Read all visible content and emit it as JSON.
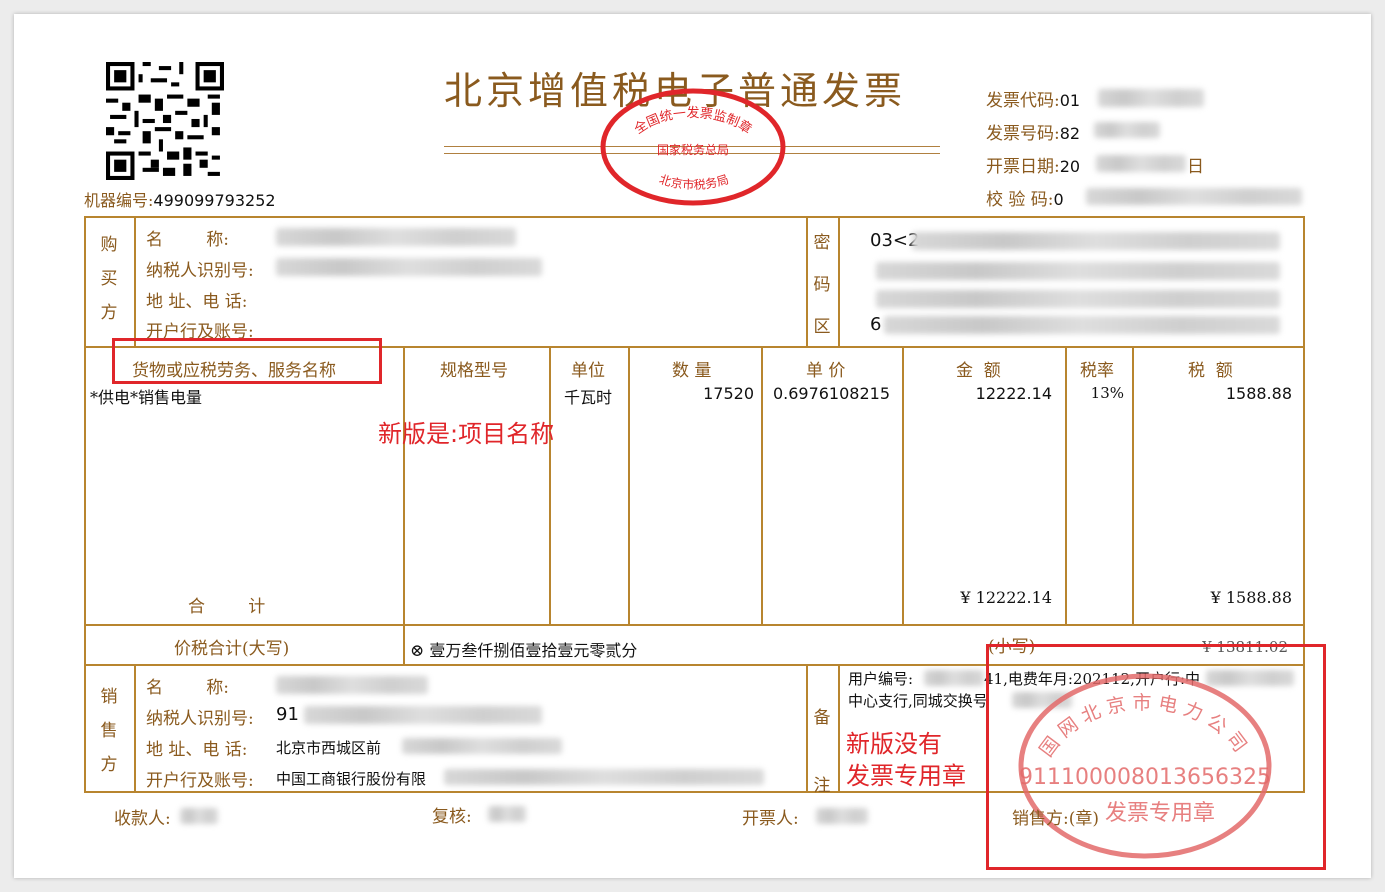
{
  "invoice": {
    "title": "北京增值税电子普通发票",
    "machine_no_label": "机器编号:",
    "machine_no": "499099793252",
    "code_label": "发票代码:",
    "code_visible": "01",
    "number_label": "发票号码:",
    "number_visible": "82",
    "date_label": "开票日期:",
    "date_visible": "20",
    "date_suffix": "日",
    "check_label": "校 验 码:",
    "check_visible": "0"
  },
  "seal_top": {
    "outer_text": "全国统一发票监制章",
    "middle": "国家税务总局",
    "bottom": "北京市税务局"
  },
  "buyer": {
    "side_label": "购买方",
    "name_label": "名        称:",
    "tax_id_label": "纳税人识别号:",
    "address_label": "地 址、电 话:",
    "bank_label": "开户行及账号:"
  },
  "cipher": {
    "side_label": "密码区",
    "line1": "03<2",
    "line2": "",
    "line4": "6"
  },
  "items_header": {
    "name": "货物或应税劳务、服务名称",
    "spec": "规格型号",
    "unit": "单位",
    "qty": "数 量",
    "price": "单 价",
    "amount": "金  额",
    "rate": "税率",
    "tax": "税  额"
  },
  "items": [
    {
      "name": "*供电*销售电量",
      "spec": "",
      "unit": "千瓦时",
      "qty": "17520",
      "price": "0.6976108215",
      "amount": "12222.14",
      "rate": "13%",
      "tax": "1588.88"
    }
  ],
  "totals": {
    "label": "合        计",
    "amount": "¥ 12222.14",
    "tax": "¥ 1588.88",
    "total_label": "价税合计(大写)",
    "total_words": "壹万叁仟捌佰壹拾壹元零贰分",
    "small_label": "(小写)",
    "small_value": "¥ 13811.02"
  },
  "seller": {
    "side_label": "销售方",
    "name_label": "名        称:",
    "tax_id_label": "纳税人识别号:",
    "tax_id_visible": "91",
    "address_label": "地 址、电 话:",
    "address_visible": "北京市西城区前",
    "bank_label": "开户行及账号:",
    "bank_visible": "中国工商银行股份有限"
  },
  "remarks": {
    "side_label": "备注",
    "line1_a": "用户编号:",
    "line1_b": "41,电费年月:202112,开户行:中",
    "line2": "中心支行,同城交换号"
  },
  "seal_bottom": {
    "company_text": "国网北京市电力公司",
    "tax_no": "911100008013656325",
    "label": "发票专用章"
  },
  "footer": {
    "payee_label": "收款人:",
    "reviewer_label": "复核:",
    "issuer_label": "开票人:",
    "seller_label": "销售方:(章)"
  },
  "annotations": {
    "new_name": "新版是:项目名称",
    "no_seal_line1": "新版没有",
    "no_seal_line2": "发票专用章"
  },
  "colors": {
    "frame": "#b8852f",
    "label_text": "#8a5a1e",
    "annotation_red": "#e0262a"
  }
}
